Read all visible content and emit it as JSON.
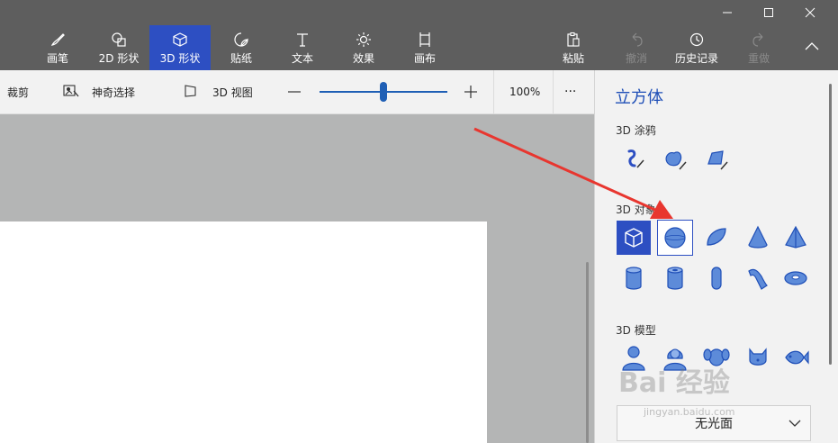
{
  "toolbar": {
    "tools": [
      {
        "label": "画笔",
        "icon": "brush-icon"
      },
      {
        "label": "2D 形状",
        "icon": "2d-shapes-icon"
      },
      {
        "label": "3D 形状",
        "icon": "3d-shapes-icon",
        "active": true
      },
      {
        "label": "贴纸",
        "icon": "stickers-icon"
      },
      {
        "label": "文本",
        "icon": "text-icon"
      },
      {
        "label": "效果",
        "icon": "effects-icon"
      },
      {
        "label": "画布",
        "icon": "canvas-icon"
      }
    ],
    "paste": "粘贴",
    "undo": "撤消",
    "history": "历史记录",
    "redo": "重做"
  },
  "subbar": {
    "crop": "裁剪",
    "magic_select": "神奇选择",
    "view3d": "3D 视图",
    "zoom": "100%",
    "zoom_level": 0.5,
    "more": "···"
  },
  "panel": {
    "title": "立方体",
    "doodles_label": "3D 涂鸦",
    "objects_label": "3D 对象",
    "models_label": "3D 模型",
    "material": "无光面"
  },
  "watermark": {
    "brand": "Bai 经验",
    "url": "jingyan.baidu.com"
  },
  "colors": {
    "accent": "#2d4fc2",
    "toolbar": "#5e5e5e",
    "panel_title": "#1f4fb7",
    "arrow": "#e8362f"
  }
}
